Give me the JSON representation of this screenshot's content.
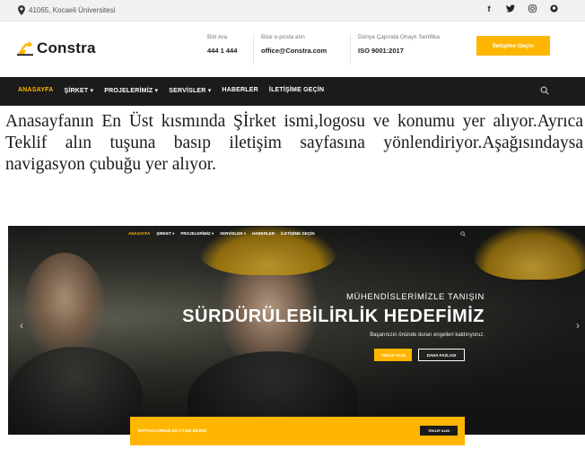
{
  "topbar": {
    "location": "41065, Kocaeli Üniversitesi",
    "social_icons": [
      "facebook-icon",
      "twitter-icon",
      "instagram-icon",
      "github-icon"
    ]
  },
  "header": {
    "logo_text": "Constra",
    "phone": {
      "label": "Bizi Ara",
      "value": "444 1 444"
    },
    "email": {
      "label": "Bize e-posta atın",
      "value": "office@Constra.com"
    },
    "cert": {
      "label": "Dünya Çapında Onaylı Sertifika",
      "value": "ISO 9001:2017"
    },
    "cta_label": "İletişime Geçin"
  },
  "nav": {
    "items": [
      {
        "label": "ANASAYFA",
        "active": true
      },
      {
        "label": "ŞİRKET ▾",
        "active": false
      },
      {
        "label": "PROJELERİMİZ ▾",
        "active": false
      },
      {
        "label": "SERVİSLER ▾",
        "active": false
      },
      {
        "label": "HABERLER",
        "active": false
      },
      {
        "label": "İLETİŞİME GEÇİN",
        "active": false
      }
    ]
  },
  "caption": "Anasayfanın En Üst kısmında Şİrket ismi,logosu ve konumu yer alıyor.Ayrıca Teklif alın tuşuna basıp iletişim sayfasına yönlendiriyor.Aşağısındaysa navigasyon çubuğu yer alıyor.",
  "hero": {
    "nav_items": [
      {
        "label": "ANASAYFA",
        "active": true
      },
      {
        "label": "ŞİRKET ▾",
        "active": false
      },
      {
        "label": "PROJELERİMİZ ▾",
        "active": false
      },
      {
        "label": "SERVİSLER ▾",
        "active": false
      },
      {
        "label": "HABERLER",
        "active": false
      },
      {
        "label": "İLETİŞİME GEÇİN",
        "active": false
      }
    ],
    "subtitle": "MÜHENDİSLERİMİZLE TANIŞIN",
    "title": "SÜRDÜRÜLEBİLİRLİK HEDEFİMİZ",
    "description": "Başarınızın önünde duran engelleri kaldırıyoruz.",
    "primary_button": "TEKLİF ALIN",
    "secondary_button": "DAHA FAZLASI",
    "prev_arrow": "‹",
    "next_arrow": "›"
  },
  "quote_bar": {
    "text": "İHTİYAÇLARINIZI EN İYİ BİZ BİLİRİZ",
    "button": "TEKLİF ALIN"
  },
  "colors": {
    "accent": "#ffb600",
    "dark": "#1b1b1b",
    "topbar": "#f1f1f1"
  }
}
